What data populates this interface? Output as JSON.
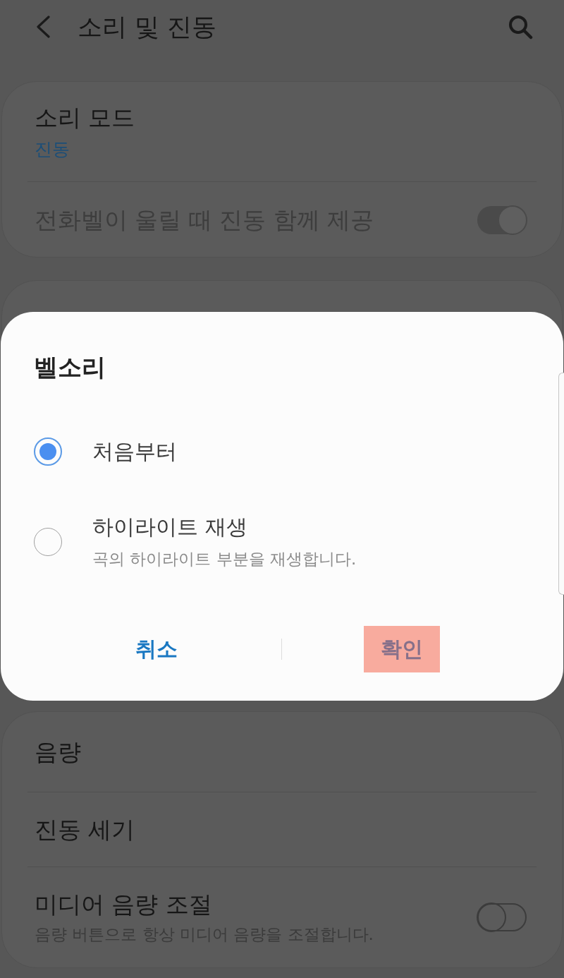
{
  "header": {
    "title": "소리 및 진동"
  },
  "sound_card": {
    "items": [
      {
        "kind": "value",
        "title": "소리 모드",
        "value": "진동"
      },
      {
        "kind": "toggle",
        "title": "전화벨이 울릴 때 진동 함께 제공",
        "on": true,
        "disabled": true
      }
    ]
  },
  "dialog": {
    "title": "벨소리",
    "options": [
      {
        "label": "처음부터",
        "selected": true
      },
      {
        "label": "하이라이트 재생",
        "description": "곡의 하이라이트 부분을 재생합니다.",
        "selected": false
      }
    ],
    "buttons": [
      {
        "label": "취소",
        "highlighted": false
      },
      {
        "label": "확인",
        "highlighted": true
      }
    ]
  },
  "volume_card": {
    "items": [
      {
        "kind": "link",
        "title": "음량"
      },
      {
        "kind": "link",
        "title": "진동 세기"
      },
      {
        "kind": "toggle",
        "title": "미디어 음량 조절",
        "description": "음량 버튼으로 항상 미디어 음량을 조절합니다.",
        "on": false,
        "disabled": false
      }
    ]
  }
}
